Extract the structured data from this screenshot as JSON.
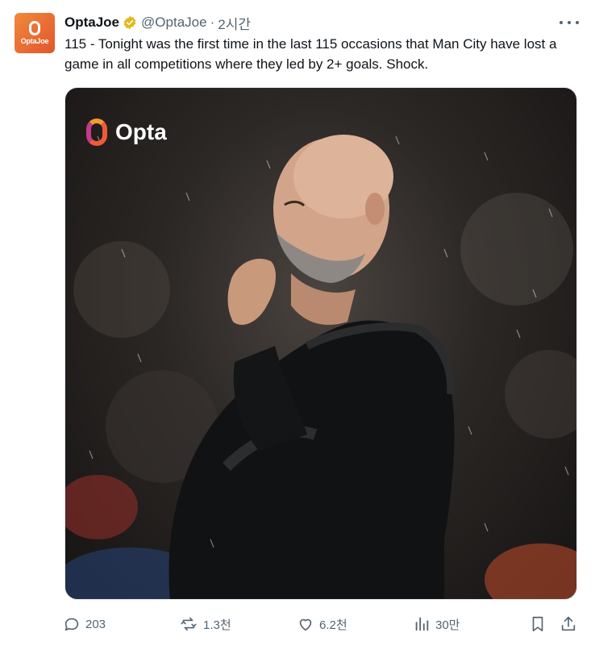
{
  "tweet": {
    "avatar_text": "OptaJoe",
    "display_name": "OptaJoe",
    "handle": "@OptaJoe",
    "separator": "·",
    "time": "2시간",
    "text": "115 - Tonight was the first time in the last 115 occasions that Man City have lost a game in all competitions where they led by 2+ goals. Shock."
  },
  "media": {
    "logo_text": "Opta",
    "image_icon": "photo-manager-in-rain"
  },
  "actions": {
    "reply_count": "203",
    "retweet_count": "1.3천",
    "like_count": "6.2천",
    "views_count": "30만"
  },
  "colors": {
    "accent_gray": "#536471",
    "verified_gold": "#e2b719",
    "avatar_orange": "#f08a3c"
  }
}
